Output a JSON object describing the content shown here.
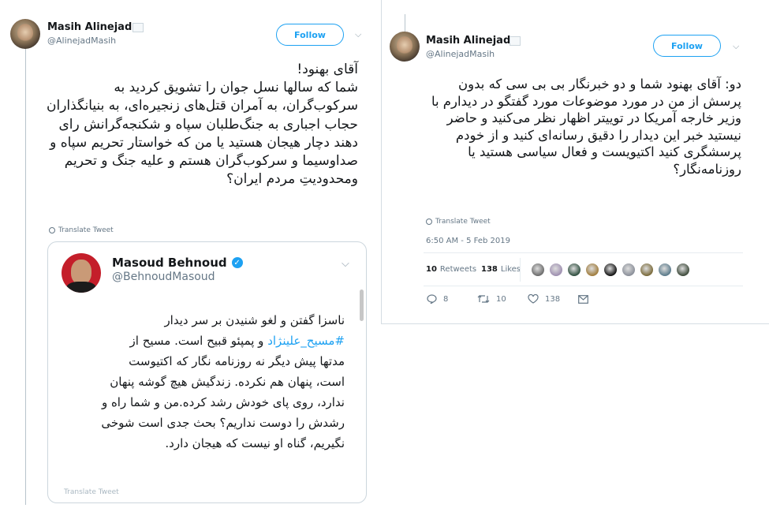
{
  "left_tweet": {
    "author_name": "Masih Alinejad",
    "author_handle": "@AlinejadMasih",
    "follow_label": "Follow",
    "text": "آقای بهنود!\nشما که سالها نسل جوان را  تشویق کردید به سرکوب‌گران، به آمران قتل‌های زنجیره‌ای، به بنیانگذاران حجاب اجباری به جنگ‌طلبان سپاه و شکنجه‌گرانش رای دهند دچار هیجان هستید یا من که خواستار تحریم سپاه و صداوسیما و سرکوب‌گران هستم و علیه جنگ و تحریم ومحدودیتِ مردم ایران؟",
    "translate_label": "Translate Tweet",
    "quoted": {
      "author_name": "Masoud Behnoud",
      "author_handle": "@BehnoudMasoud",
      "line1": "ناسزا گفتن و لغو شنیدن بر سر دیدار",
      "hashtag": "#مسیح_علینژاد",
      "line2_rest": " و پمپئو قبیح است. مسیح از",
      "line3": "مدتها پیش دیگر نه روزنامه نگار که اکتیوست",
      "line4": "است، پنهان هم نکرده. زندگیش هیچ گوشه پنهان",
      "line5": "ندارد، روی پای خودش رشد کرده.من و شما راه و",
      "line6": "رشدش را دوست نداریم؟ بحث جدی است شوخی",
      "line7": "نگیریم، گناه او نیست که هیجان دارد.",
      "translate_label": "Translate Tweet"
    }
  },
  "right_tweet": {
    "author_name": "Masih Alinejad",
    "author_handle": "@AlinejadMasih",
    "follow_label": "Follow",
    "text": "دو: آقای بهنود شما و دو خبرنگار بی بی سی که بدون پرسش از من در مورد موضوعات مورد گفتگو در دیدارم با وزیر خارجه آمریکا در توییتر اظهار نظر می‌کنید و حاضر نیستید خبر این دیدار را دقیق رسانه‌ای کنید و از خودم پرسشگری کنید اکتیویست و فعال سیاسی هستید یا روزنامه‌نگار؟",
    "translate_label": "Translate Tweet",
    "timestamp": "6:50 AM - 5 Feb 2019",
    "retweets_count": "10",
    "retweets_label": "Retweets",
    "likes_count": "138",
    "likes_label": "Likes",
    "likers": [
      "#6b6b6b",
      "#9e8fb0",
      "#2f4f3f",
      "#a07c3c",
      "#111111",
      "#8a8f99",
      "#7a6a3a",
      "#5a7a8a",
      "#3d4a3a"
    ],
    "actions": {
      "reply_count": "8",
      "retweet_count": "10",
      "like_count": "138"
    }
  },
  "colors": {
    "accent": "#1da1f2",
    "secondary_text": "#657786",
    "border": "#ccd6dd"
  }
}
